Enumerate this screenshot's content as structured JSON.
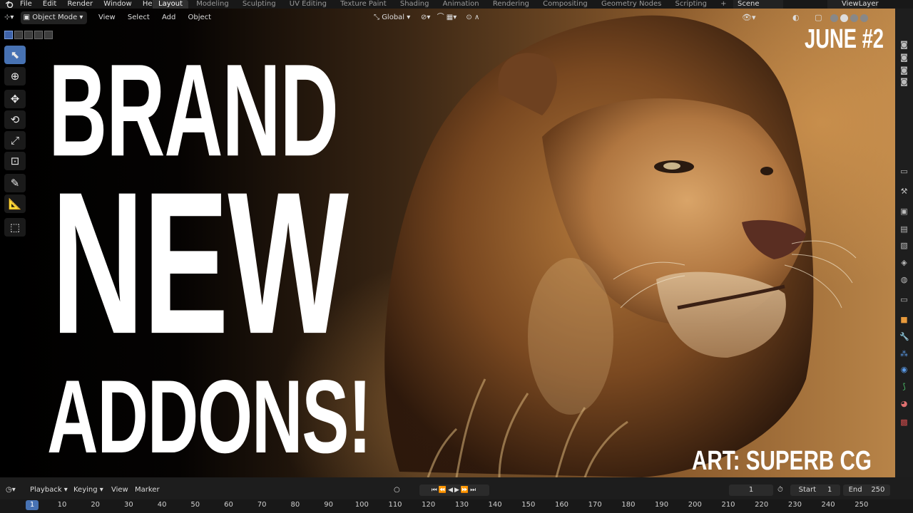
{
  "topbar": {
    "menu": [
      "File",
      "Edit",
      "Render",
      "Window",
      "Help"
    ],
    "workspaces": [
      "Layout",
      "Modeling",
      "Sculpting",
      "UV Editing",
      "Texture Paint",
      "Shading",
      "Animation",
      "Rendering",
      "Compositing",
      "Geometry Nodes",
      "Scripting"
    ],
    "active_workspace": "Layout",
    "add_tab": "+",
    "scene": "Scene",
    "view_layer": "ViewLayer"
  },
  "viewport_header": {
    "mode": "Object Mode",
    "menu": [
      "View",
      "Select",
      "Add",
      "Object"
    ],
    "orientation": "Global"
  },
  "overlay": {
    "line1": "BRAND",
    "line2": "NEW",
    "line3": "ADDONS!",
    "badge": "JUNE #2",
    "credit": "ART: SUPERB CG"
  },
  "timeline": {
    "menu": [
      "Playback",
      "Keying",
      "View",
      "Marker"
    ],
    "current_frame": "1",
    "start_label": "Start",
    "start": "1",
    "end_label": "End",
    "end": "250",
    "ruler_marks": [
      "1",
      "10",
      "20",
      "30",
      "40",
      "50",
      "60",
      "70",
      "80",
      "90",
      "100",
      "110",
      "120",
      "130",
      "140",
      "150",
      "160",
      "170",
      "180",
      "190",
      "200",
      "210",
      "220",
      "230",
      "240",
      "250"
    ]
  },
  "colors": {
    "accent": "#4772b3",
    "ui_bg": "#1d1d1d",
    "headline": "#ffffff"
  }
}
